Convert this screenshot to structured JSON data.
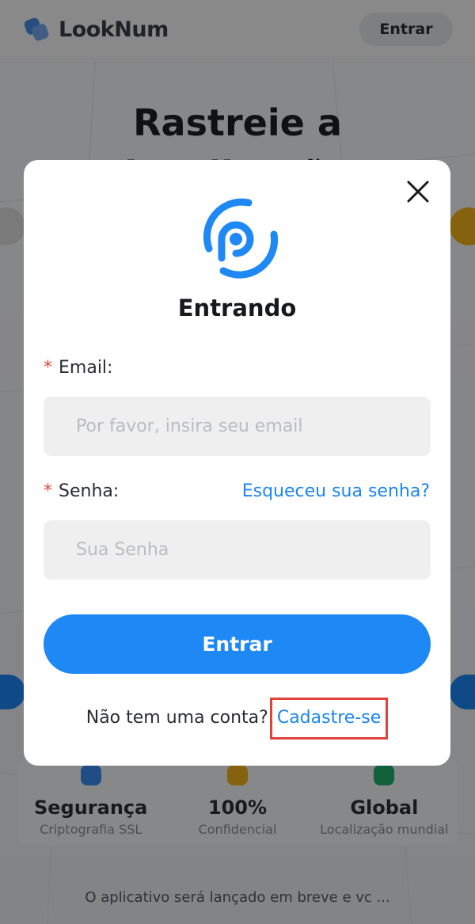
{
  "header": {
    "logo_text": "LookNum",
    "login_button": "Entrar"
  },
  "hero": {
    "title_line1": "Rastreie a",
    "title_line2": "localização"
  },
  "features": [
    {
      "title": "Segurança",
      "subtitle": "Criptografia SSL",
      "icon_color": "#3b8ef0"
    },
    {
      "title": "100%",
      "subtitle": "Confidencial",
      "icon_color": "#f2b51a"
    },
    {
      "title": "Global",
      "subtitle": "Localização mundial",
      "icon_color": "#20b36b"
    }
  ],
  "notice_text": "O aplicativo será lançado em breve e vc ...",
  "modal": {
    "title": "Entrando",
    "email_label": "Email:",
    "email_placeholder": "Por favor, insira seu email",
    "senha_label": "Senha:",
    "senha_placeholder": "Sua Senha",
    "forgot_link": "Esqueceu sua senha?",
    "submit_label": "Entrar",
    "signup_prompt": "Não tem uma conta?",
    "signup_link": "Cadastre-se",
    "required_mark": "*"
  },
  "colors": {
    "accent": "#1e88f5",
    "link": "#1a86f2",
    "required": "#e2483d",
    "highlight_box": "#e0433b"
  },
  "icons": {
    "close": "close-icon",
    "brand": "looknum-brand-icon"
  }
}
